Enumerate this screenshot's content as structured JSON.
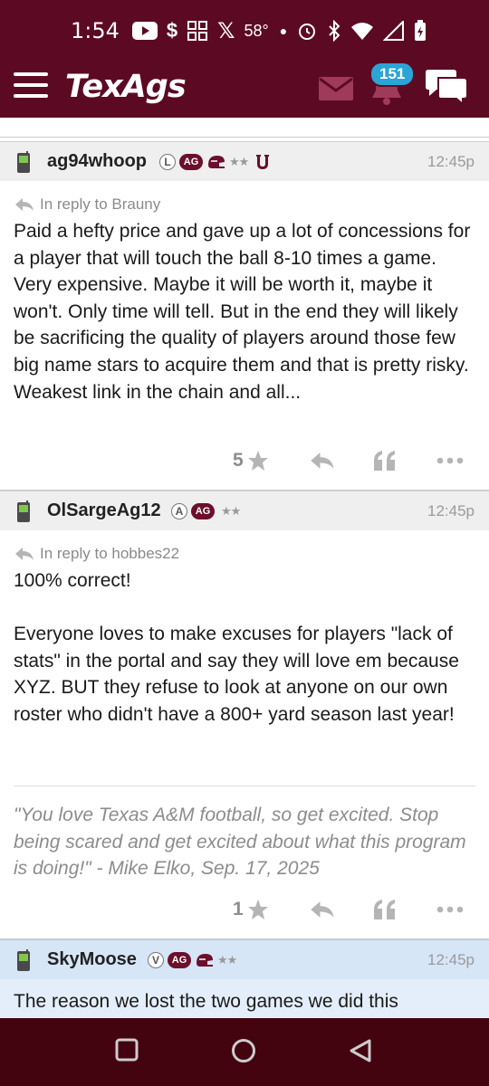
{
  "status_bar": {
    "time": "1:54",
    "temperature": "58°",
    "icons": [
      "youtube-icon",
      "dollar-icon",
      "apps-icon",
      "x-icon",
      "dot-icon",
      "alarm-icon",
      "bluetooth-icon",
      "wifi-icon",
      "signal-icon",
      "battery-icon"
    ]
  },
  "header": {
    "logo": "TexAgs",
    "notification_count": "151",
    "brand_color": "#5c0a24"
  },
  "posts": [
    {
      "username": "ag94whoop",
      "badge_letter": "L",
      "ag_tag": "AG",
      "stars": "★★",
      "time": "12:45p",
      "reply_to": "In reply to Brauny",
      "body": "Paid a hefty price and gave up a lot of concessions for a player that will touch the ball 8-10 times a game. Very expensive. Maybe it will be worth it, maybe it won't. Only time will tell. But in the end they will likely be sacrificing the quality of players around those few big name stars to acquire them and that is pretty risky.\nWeakest link in the chain and all...",
      "likes": "5"
    },
    {
      "username": "OlSargeAg12",
      "badge_letter": "A",
      "ag_tag": "AG",
      "stars": "★★",
      "time": "12:45p",
      "reply_to": "In reply to hobbes22",
      "body": "100% correct!\n\nEveryone loves to make excuses for players \"lack of stats\" in the portal and say they will love em because XYZ. BUT they refuse to look at anyone on our own roster who didn't have a 800+ yard season last year!",
      "signature": "\"You love Texas A&M football, so get excited. Stop being scared and get excited about what this program is doing!\" - Mike Elko, Sep. 17, 2025",
      "likes": "1"
    },
    {
      "username": "SkyMoose",
      "badge_letter": "V",
      "ag_tag": "AG",
      "stars": "★★",
      "time": "12:45p",
      "body": "The reason we lost the two games we did this"
    }
  ]
}
